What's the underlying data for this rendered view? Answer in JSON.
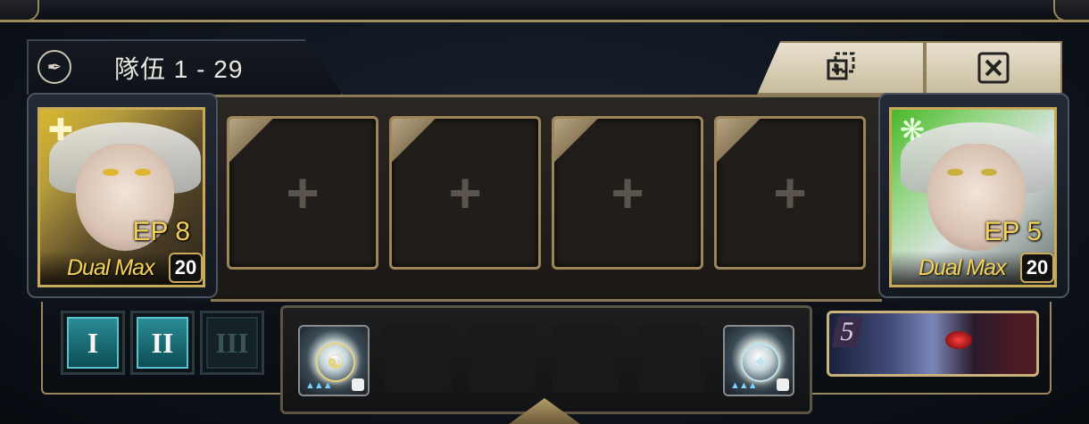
{
  "header": {
    "title_label": "隊伍",
    "title_range": "1 - 29",
    "quill_icon": "quill-icon",
    "copy_icon": "copy-add-icon",
    "close_icon": "close-icon"
  },
  "leaders": [
    {
      "element_icon": "light-element-icon",
      "ep": "EP 8",
      "status": "Dual Max",
      "level": "20"
    },
    {
      "element_icon": "wood-element-icon",
      "ep": "EP 5",
      "status": "Dual Max",
      "level": "20"
    }
  ],
  "member_slots": [
    {
      "state": "empty"
    },
    {
      "state": "empty"
    },
    {
      "state": "empty"
    },
    {
      "state": "empty"
    }
  ],
  "team_tabs": [
    {
      "label": "I",
      "state": "active"
    },
    {
      "label": "II",
      "state": "active"
    },
    {
      "label": "III",
      "state": "inactive"
    }
  ],
  "accessories": [
    {
      "state": "filled"
    },
    {
      "state": "empty"
    },
    {
      "state": "empty"
    },
    {
      "state": "empty"
    },
    {
      "state": "empty"
    },
    {
      "state": "filled"
    }
  ],
  "mech_card": {
    "number": "5"
  },
  "colors": {
    "gold": "#f4d25a",
    "frame": "#9c855a",
    "teal": "#2a8b95"
  }
}
